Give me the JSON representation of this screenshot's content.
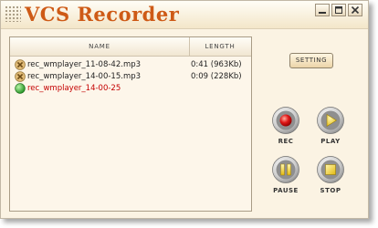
{
  "app": {
    "title": "VCS Recorder"
  },
  "window_controls": [
    "minimize-icon",
    "maximize-icon",
    "close-icon"
  ],
  "list": {
    "columns": {
      "name": "NAME",
      "length": "LENGTH"
    },
    "rows": [
      {
        "name": "rec_wmplayer_11-08-42.mp3",
        "length": "0:41 (963Kb)",
        "icon": "file-x-icon",
        "active": false
      },
      {
        "name": "rec_wmplayer_14-00-15.mp3",
        "length": "0:09 (228Kb)",
        "icon": "file-x-icon",
        "active": false
      },
      {
        "name": "rec_wmplayer_14-00-25",
        "length": "",
        "icon": "recording-active-icon",
        "active": true
      }
    ]
  },
  "buttons": {
    "setting": "SETTING",
    "rec": "REC",
    "play": "PLAY",
    "pause": "PAUSE",
    "stop": "STOP"
  },
  "colors": {
    "title": "#ce5a16",
    "background": "#fbf3e3",
    "active_row": "#c40000",
    "rec_red": "#e01818",
    "control_yellow": "#f2d21c",
    "active_green": "#2fb52f"
  }
}
